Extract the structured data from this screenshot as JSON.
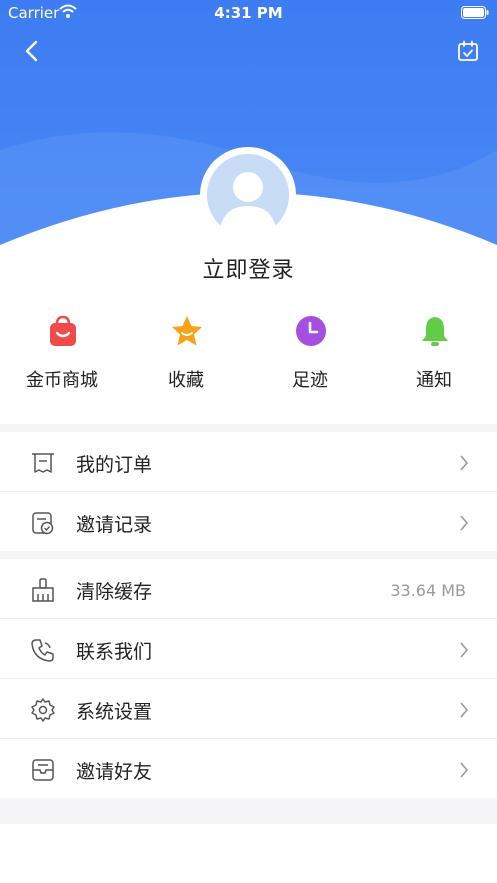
{
  "status_bar": {
    "carrier": "Carrier",
    "time": "4:31 PM"
  },
  "header": {
    "bg_color": "#3d7cf2",
    "back_icon": "back-arrow-icon",
    "action_icon": "calendar-check-icon"
  },
  "profile": {
    "login_label": "立即登录"
  },
  "shortcuts": [
    {
      "label": "金币商城",
      "icon": "shopping-bag-icon",
      "color": "#f04a4a"
    },
    {
      "label": "收藏",
      "icon": "star-icon",
      "color": "#f7a21b"
    },
    {
      "label": "足迹",
      "icon": "clock-icon",
      "color": "#a54ee0"
    },
    {
      "label": "通知",
      "icon": "bell-icon",
      "color": "#62cc48"
    }
  ],
  "menu_group1": [
    {
      "label": "我的订单",
      "icon": "order-icon"
    },
    {
      "label": "邀请记录",
      "icon": "invite-record-icon"
    }
  ],
  "menu_group2": [
    {
      "label": "清除缓存",
      "icon": "broom-icon",
      "value": "33.64 MB"
    },
    {
      "label": "联系我们",
      "icon": "phone-icon"
    },
    {
      "label": "系统设置",
      "icon": "gear-icon"
    },
    {
      "label": "邀请好友",
      "icon": "mail-icon"
    }
  ]
}
